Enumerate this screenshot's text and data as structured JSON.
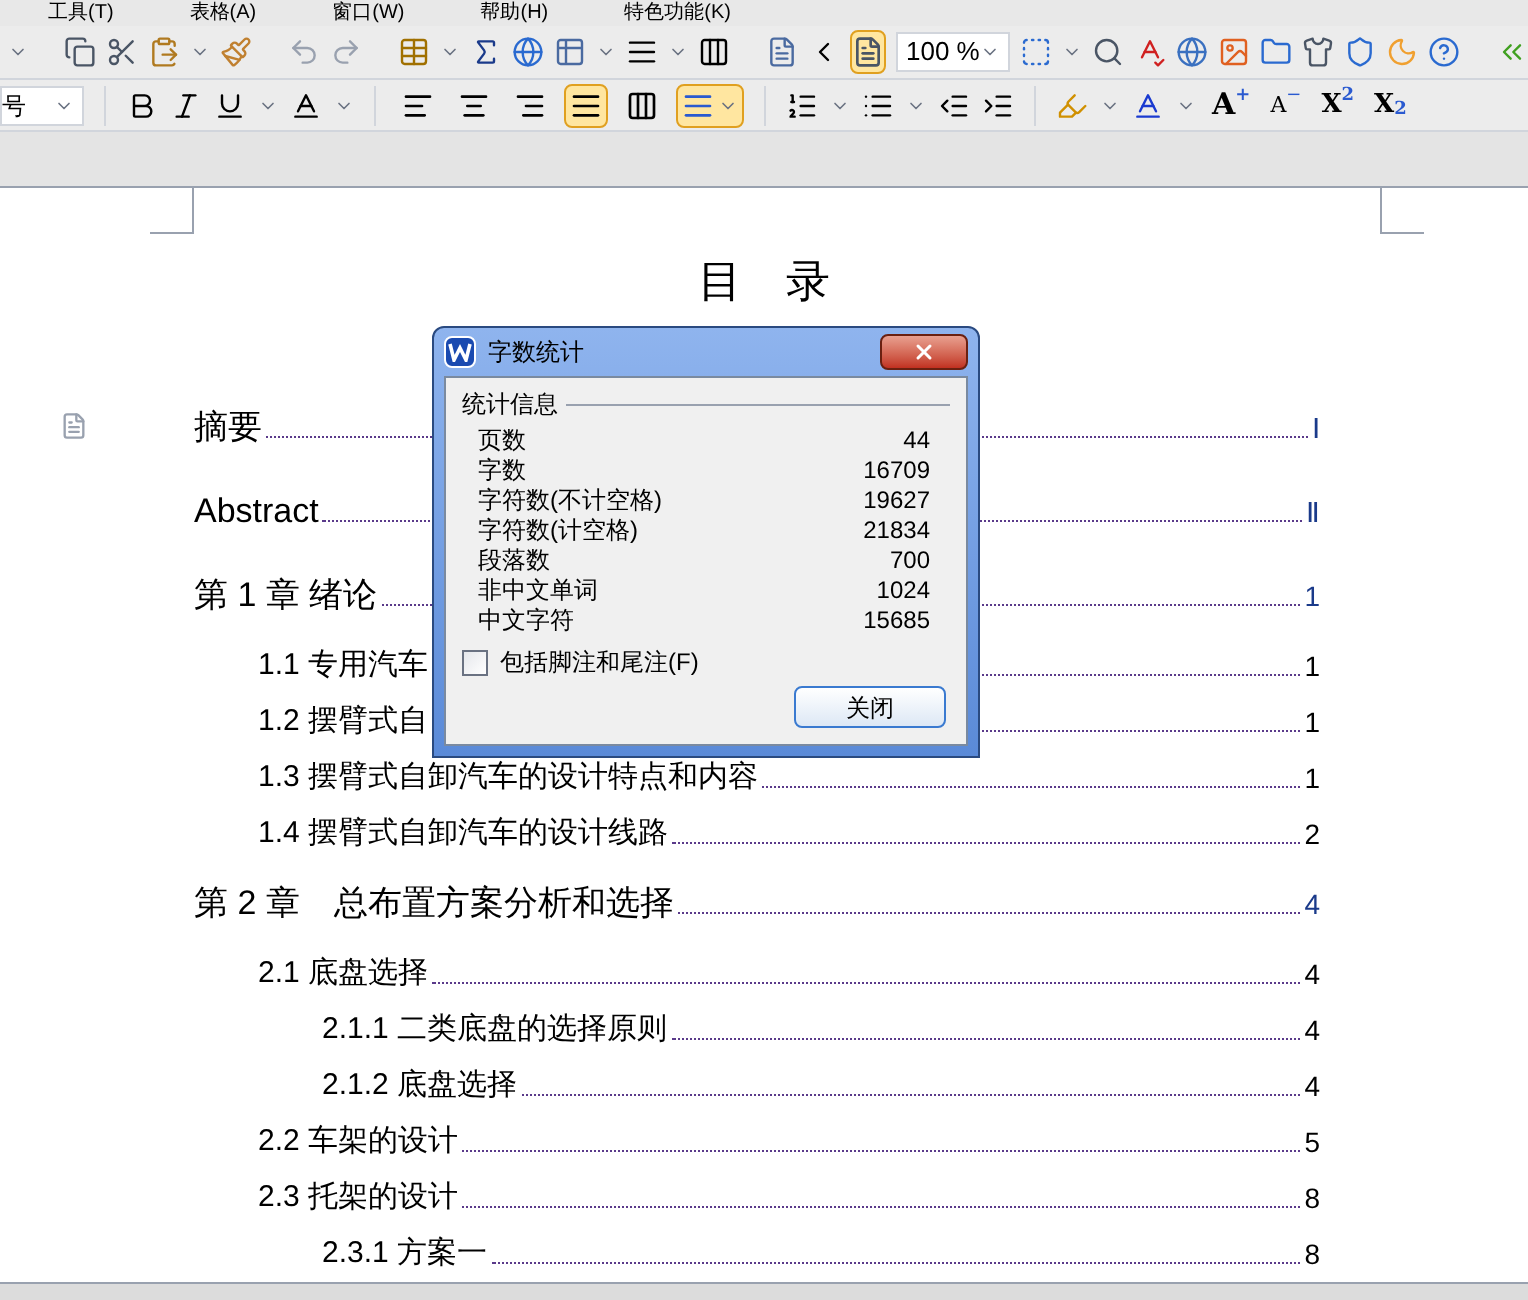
{
  "menu": [
    "工具(T)",
    "表格(A)",
    "窗口(W)",
    "帮助(H)",
    "特色功能(K)"
  ],
  "toolbar": {
    "page_view_selected": true,
    "zoom": "100 %"
  },
  "format_bar": {
    "font_size": "号",
    "align_buttons": [
      {
        "kind": "left",
        "selected": false
      },
      {
        "kind": "center",
        "selected": false
      },
      {
        "kind": "right",
        "selected": false
      },
      {
        "kind": "justify",
        "selected": true
      },
      {
        "kind": "distribute",
        "selected": false
      }
    ],
    "line_spacing_selected": true,
    "font_buttons": [
      {
        "kind": "grow",
        "letter": "A",
        "mark": "+"
      },
      {
        "kind": "shrink",
        "letter": "A",
        "mark": "−"
      },
      {
        "kind": "superscript",
        "letter": "X",
        "mark": "2"
      },
      {
        "kind": "subscript",
        "letter": "X",
        "mark": "2"
      }
    ]
  },
  "document": {
    "title": "目　录",
    "toc": [
      {
        "title": "摘要",
        "page": "Ⅰ"
      },
      {
        "title": "Abstract",
        "page": "Ⅱ"
      },
      {
        "title": "第 1 章  绪论",
        "page": "1",
        "children": [
          {
            "title": "1.1 专用汽车",
            "page": "1"
          },
          {
            "title": "1.2 摆臂式自",
            "page": "1"
          },
          {
            "title": "1.3 摆臂式自卸汽车的设计特点和内容",
            "page": "1"
          },
          {
            "title": "1.4 摆臂式自卸汽车的设计线路",
            "page": "2"
          }
        ]
      },
      {
        "title": "第 2 章　总布置方案分析和选择",
        "page": "4",
        "children": [
          {
            "title": "2.1  底盘选择",
            "page": "4",
            "children": [
              {
                "title": "2.1.1 二类底盘的选择原则",
                "page": "4"
              },
              {
                "title": "2.1.2 底盘选择",
                "page": "4"
              }
            ]
          },
          {
            "title": "2.2 车架的设计",
            "page": "5"
          },
          {
            "title": "2.3  托架的设计",
            "page": "8",
            "children": [
              {
                "title": "2.3.1 方案一",
                "page": "8"
              }
            ]
          }
        ]
      }
    ]
  },
  "dialog": {
    "title": "字数统计",
    "group": "统计信息",
    "stats": [
      {
        "label": "页数",
        "value": "44"
      },
      {
        "label": "字数",
        "value": "16709"
      },
      {
        "label": "字符数(不计空格)",
        "value": "19627"
      },
      {
        "label": "字符数(计空格)",
        "value": "21834"
      },
      {
        "label": "段落数",
        "value": "700"
      },
      {
        "label": "非中文单词",
        "value": "1024"
      },
      {
        "label": "中文字符",
        "value": "15685"
      }
    ],
    "checkbox": {
      "label": "包括脚注和尾注(F)",
      "checked": false
    },
    "close_button": "关闭"
  }
}
